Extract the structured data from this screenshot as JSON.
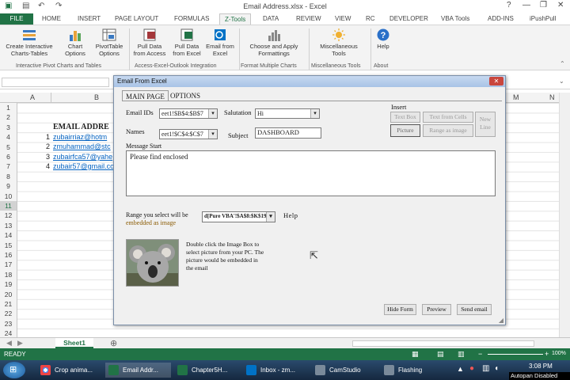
{
  "window": {
    "title": "Email Address.xlsx - Excel",
    "controls": [
      "?",
      "—",
      "❐",
      "✕"
    ]
  },
  "ribbon_tabs": [
    "FILE",
    "HOME",
    "INSERT",
    "PAGE LAYOUT",
    "FORMULAS",
    "Z-Tools",
    "DATA",
    "REVIEW",
    "VIEW",
    "RC",
    "DEVELOPER",
    "VBA Tools",
    "ADD-INS",
    "iPushPull"
  ],
  "active_tab": "Z-Tools",
  "ribbon": {
    "buttons": [
      {
        "label": "Create Interactive Charts-Tables",
        "icon": "interactive-charts-icon"
      },
      {
        "label": "Chart Options",
        "icon": "chart-icon"
      },
      {
        "label": "PivotTable Options",
        "icon": "pivottable-icon"
      },
      {
        "label": "Pull Data from Access",
        "icon": "access-icon"
      },
      {
        "label": "Pull Data from Excel",
        "icon": "excel-icon"
      },
      {
        "label": "Email from Excel",
        "icon": "outlook-icon"
      },
      {
        "label": "Choose and Apply Formattings",
        "icon": "format-icon"
      },
      {
        "label": "Miscellaneous Tools",
        "icon": "sun-icon"
      },
      {
        "label": "Help",
        "icon": "help-icon"
      }
    ],
    "groups": [
      "Interactive Pivot Charts and Tables",
      "Access-Excel-Outlook Integration",
      "Format Multiple Charts",
      "Miscellaneous Tools",
      "About"
    ]
  },
  "columns": [
    "A",
    "B",
    "M",
    "N"
  ],
  "rows": [
    "1",
    "2",
    "3",
    "4",
    "5",
    "6",
    "7",
    "8",
    "9",
    "10",
    "11",
    "12",
    "13",
    "14",
    "15",
    "16",
    "17",
    "18",
    "19",
    "20",
    "21",
    "22",
    "23",
    "24"
  ],
  "selected_row": "11",
  "sheet": {
    "heading": "EMAIL ADDRE",
    "numbers": [
      "1",
      "2",
      "3",
      "4"
    ],
    "emails": [
      "zubairriaz@hotm",
      "zmuhammad@stc",
      "zubairfca57@yahe",
      "zubair57@gmail.co"
    ]
  },
  "sheet_tab": "Sheet1",
  "status": {
    "ready": "READY",
    "zoom": "100%"
  },
  "taskbar": [
    "Crop anima...",
    "Email Addr...",
    "Chapter5H...",
    "Inbox - zm...",
    "CamStudio",
    "Flashing"
  ],
  "clock": {
    "time": "3:08 PM"
  },
  "autopan": "Autopan Disabled",
  "dialog": {
    "title": "Email From Excel",
    "close": "✕",
    "tabs": [
      "MAIN PAGE",
      "OPTIONS"
    ],
    "email_ids_label": "Email IDs",
    "email_ids_value": "eet1!$B$4:$B$7",
    "names_label": "Names",
    "names_value": "eet1!$C$4:$C$7",
    "salutation_label": "Salutation",
    "salutation_value": "Hi",
    "subject_label": "Subject",
    "subject_value": "DASHBOARD",
    "insert_label": "Insert",
    "insert_buttons": [
      "Text Box",
      "Text from Cells",
      "New Line",
      "Picture",
      "Range as image"
    ],
    "message_label": "Message Start",
    "message_value": "Please find enclosed",
    "range_label_1": "Range you select will be",
    "range_label_2": "embedded as image",
    "range_value": "d[Pure VBA'!$A$8:$K$19",
    "help_label": "Help",
    "image_hint": "Double click the Image Box to select picture from your PC. The picture would be embedded in the email",
    "footer_buttons": [
      "Hide Form",
      "Preview",
      "Send email"
    ]
  }
}
